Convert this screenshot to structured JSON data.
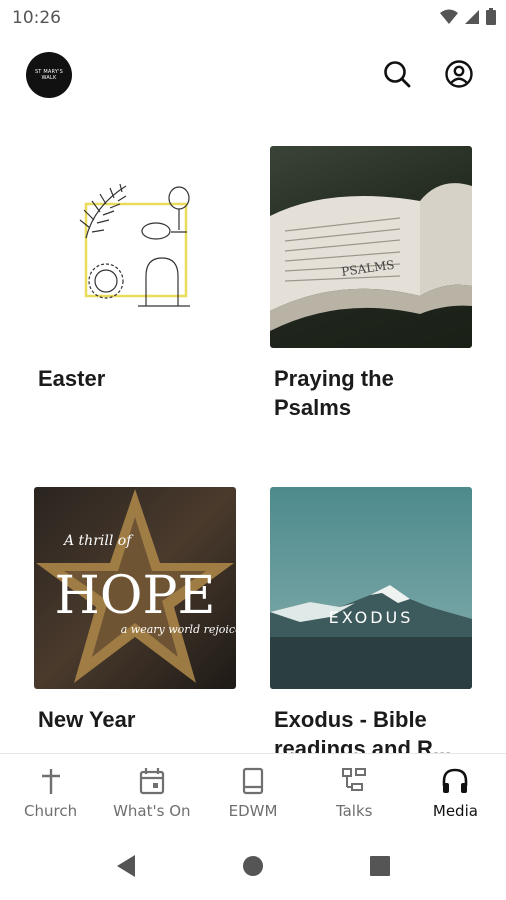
{
  "status": {
    "time": "10:26"
  },
  "header": {
    "logo_text": "ST MARY'S",
    "logo_sub": "WALK",
    "search_icon": "search-icon",
    "account_icon": "account-icon"
  },
  "cards": [
    {
      "title": "Easter"
    },
    {
      "title": "Praying the Psalms",
      "image_text": "PSALMS"
    },
    {
      "title": "New Year",
      "image_line1": "A thrill of",
      "image_line2": "HOPE",
      "image_line3": "a weary world rejoices"
    },
    {
      "title": "Exodus - Bible readings and R...",
      "image_text": "EXODUS"
    }
  ],
  "nav": [
    {
      "label": "Church",
      "icon": "cross-icon"
    },
    {
      "label": "What's On",
      "icon": "calendar-icon"
    },
    {
      "label": "EDWM",
      "icon": "book-icon"
    },
    {
      "label": "Talks",
      "icon": "talks-icon"
    },
    {
      "label": "Media",
      "icon": "headphones-icon",
      "active": true
    }
  ],
  "colors": {
    "active": "#111111",
    "inactive": "#6f6f6f"
  }
}
